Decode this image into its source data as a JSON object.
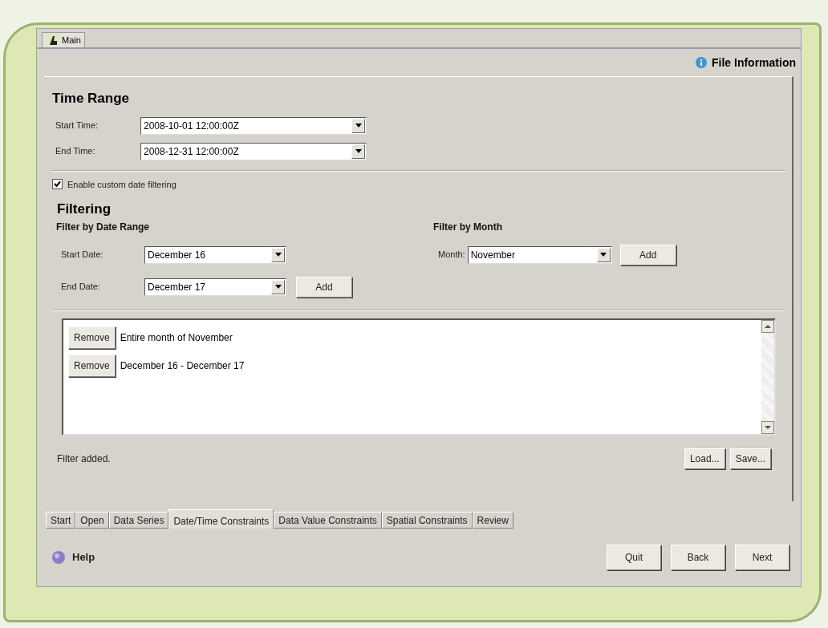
{
  "main_tab": {
    "label": "Main",
    "selected": true
  },
  "file_information": "File Information",
  "time_range": {
    "heading": "Time Range",
    "fields": [
      {
        "label": "Start Time:",
        "value": "2008-10-01 12:00:00Z"
      },
      {
        "label": "End Time:",
        "value": "2008-12-31 12:00:00Z"
      }
    ]
  },
  "custom_date_filtering": {
    "label": "Enable custom date filtering",
    "checked": true
  },
  "filtering": {
    "heading": "Filtering",
    "date_range": {
      "heading": "Filter by Date Range",
      "fields": [
        {
          "label": "Start Date:",
          "value": "December 16"
        },
        {
          "label": "End Date:",
          "value": "December 17"
        }
      ],
      "add_button": "Add"
    },
    "month": {
      "heading": "Filter by Month",
      "label": "Month:",
      "value": "November",
      "add_button": "Add"
    }
  },
  "filters": [
    {
      "button": "Remove",
      "text": "Entire month of November"
    },
    {
      "button": "Remove",
      "text": "December 16 - December 17"
    }
  ],
  "status": "Filter added.",
  "file_buttons": [
    "Load...",
    "Save..."
  ],
  "tabs": [
    {
      "label": "Start",
      "selected": false
    },
    {
      "label": "Open",
      "selected": false
    },
    {
      "label": "Data Series",
      "selected": false
    },
    {
      "label": "Date/Time Constraints",
      "selected": true
    },
    {
      "label": "Data Value Constraints",
      "selected": false
    },
    {
      "label": "Spatial Constraints",
      "selected": false
    },
    {
      "label": "Review",
      "selected": false
    }
  ],
  "help": "Help",
  "nav_buttons": [
    "Quit",
    "Back",
    "Next"
  ]
}
